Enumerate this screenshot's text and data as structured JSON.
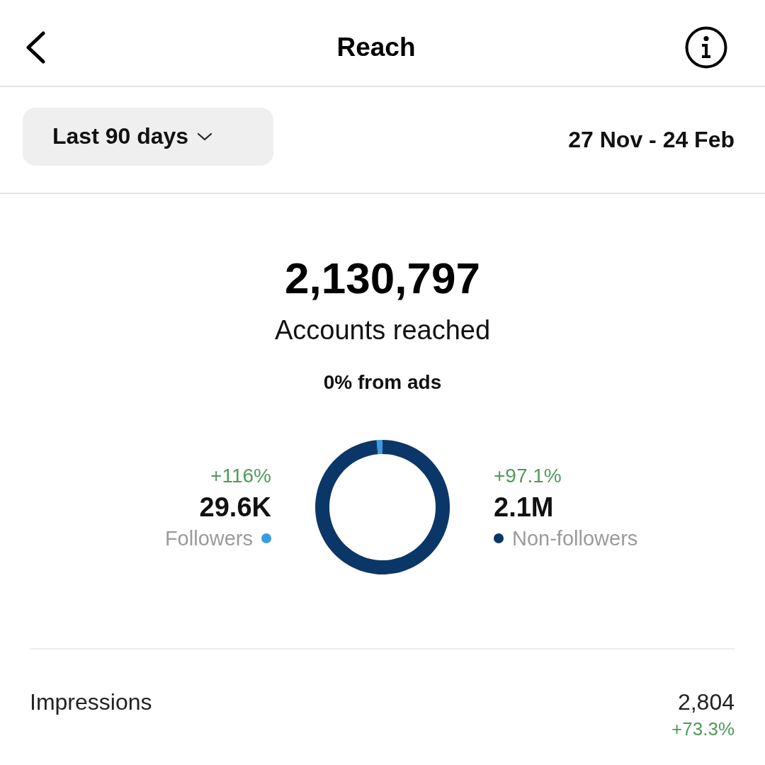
{
  "header": {
    "title": "Reach"
  },
  "filter": {
    "range": "Last 90 days",
    "dates": "27 Nov - 24 Feb"
  },
  "summary": {
    "total": "2,130,797",
    "label": "Accounts reached",
    "ads_share": "0% from ads"
  },
  "audience": {
    "groups": [
      {
        "change": "+116%",
        "value": "29.6K",
        "color": "#3a9be0"
      },
      {
        "change": "+97.1%",
        "value": "2.1M",
        "color": "#0b3768"
      }
    ],
    "chart_data": {
      "type": "donut",
      "categories": [
        "Followers",
        "Non-followers"
      ],
      "values": [
        1.4,
        98.6
      ]
    }
  },
  "metrics": [
    {
      "label": "Impressions",
      "value": "2,804",
      "change": "+73.3%"
    }
  ]
}
